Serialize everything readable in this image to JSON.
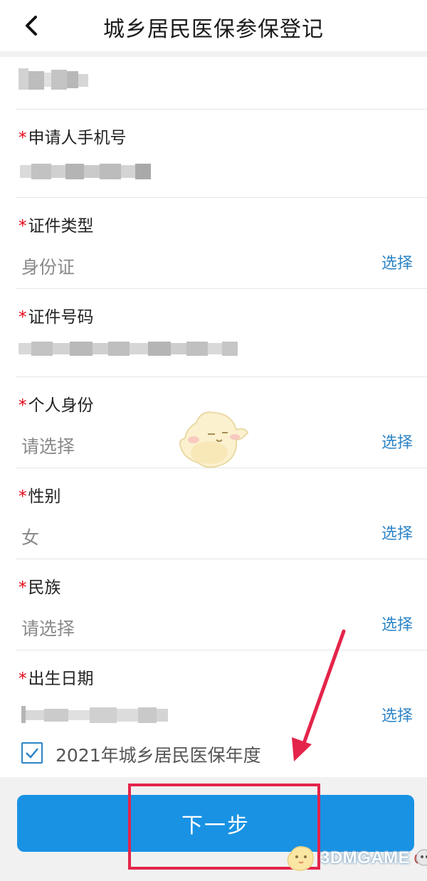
{
  "header": {
    "title": "城乡居民医保参保登记"
  },
  "fields": [
    {
      "label": "申请人手机号",
      "required": true,
      "value": "",
      "masked": true
    },
    {
      "label": "证件类型",
      "required": true,
      "value": "身份证",
      "action": "选择"
    },
    {
      "label": "证件号码",
      "required": true,
      "value": "",
      "masked": true
    },
    {
      "label": "个人身份",
      "required": true,
      "placeholder": "请选择",
      "action": "选择"
    },
    {
      "label": "性别",
      "required": true,
      "value": "女",
      "action": "选择"
    },
    {
      "label": "民族",
      "required": true,
      "placeholder": "请选择",
      "action": "选择"
    },
    {
      "label": "出生日期",
      "required": true,
      "value": "",
      "masked": true,
      "action": "选择"
    }
  ],
  "required_mark": "*",
  "year_option": {
    "label": "2021年城乡居民医保年度",
    "checked": true
  },
  "next_button": {
    "label": "下一步"
  },
  "watermark": {
    "text": "3DMGAME"
  },
  "colors": {
    "accent": "#1992e4",
    "link": "#2d84c6",
    "required": "#e60012",
    "annotation": "#e4244a"
  }
}
